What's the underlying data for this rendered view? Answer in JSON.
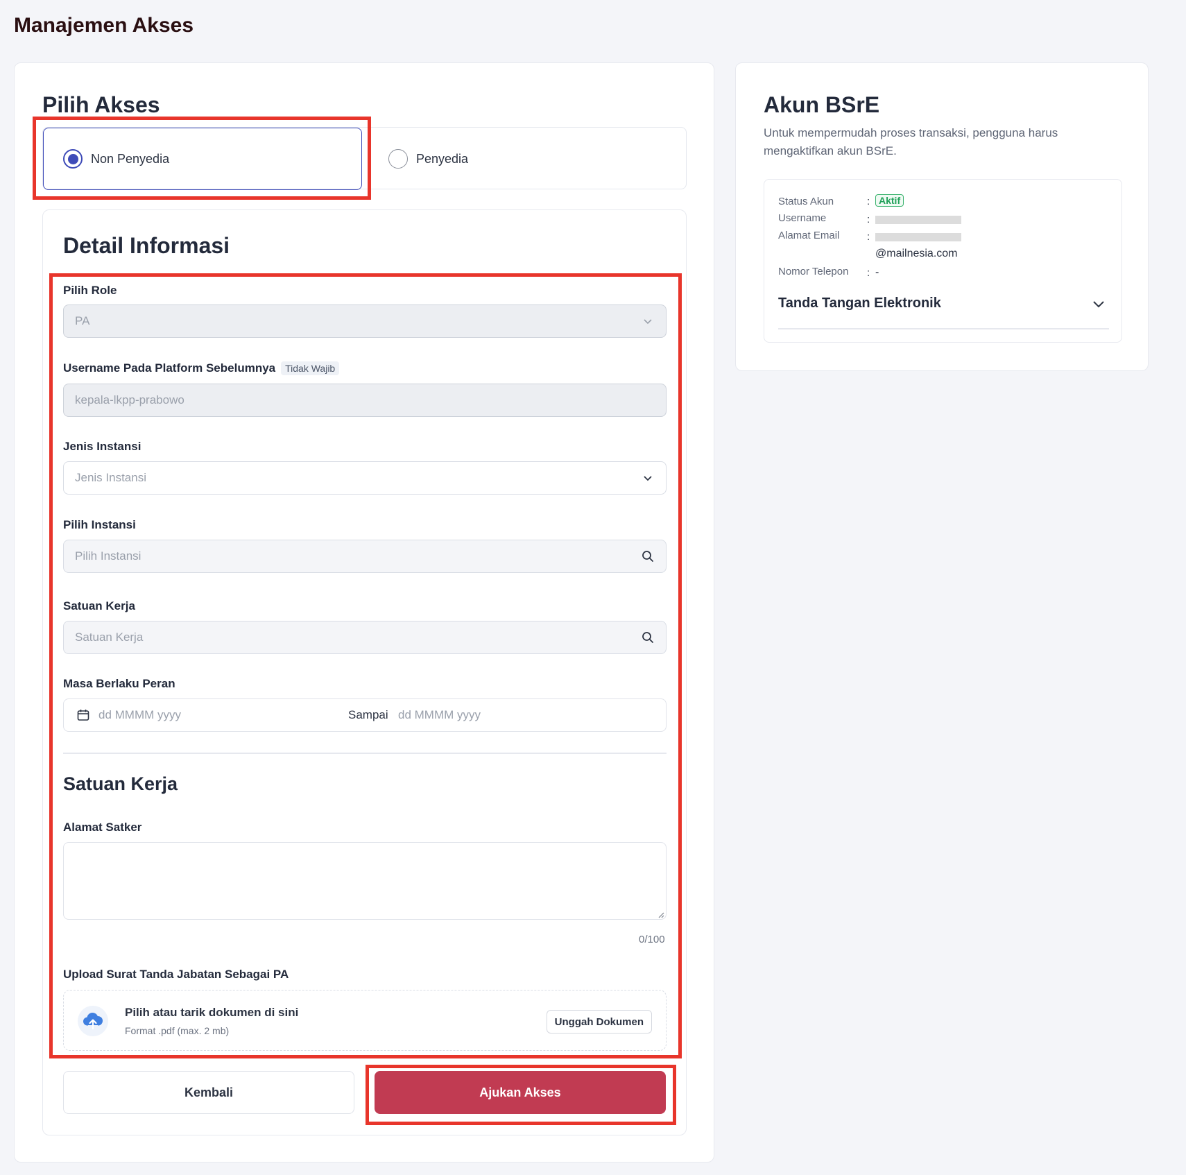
{
  "page": {
    "title": "Manajemen Akses"
  },
  "access": {
    "title": "Pilih Akses",
    "options": [
      {
        "label": "Non Penyedia",
        "selected": true
      },
      {
        "label": "Penyedia",
        "selected": false
      }
    ]
  },
  "detail": {
    "title": "Detail Informasi",
    "role": {
      "label": "Pilih Role",
      "value": "PA"
    },
    "username": {
      "label": "Username Pada Platform Sebelumnya",
      "badge": "Tidak Wajib",
      "placeholder": "kepala-lkpp-prabowo"
    },
    "jenis_instansi": {
      "label": "Jenis Instansi",
      "placeholder": "Jenis Instansi"
    },
    "instansi": {
      "label": "Pilih Instansi",
      "placeholder": "Pilih Instansi"
    },
    "satuan_kerja": {
      "label": "Satuan Kerja",
      "placeholder": "Satuan Kerja"
    },
    "masa_berlaku": {
      "label": "Masa Berlaku Peran",
      "start_placeholder": "dd MMMM yyyy",
      "separator": "Sampai",
      "end_placeholder": "dd MMMM yyyy"
    }
  },
  "satker": {
    "title": "Satuan Kerja",
    "alamat": {
      "label": "Alamat Satker",
      "value": "",
      "counter": "0/100"
    },
    "upload": {
      "label": "Upload Surat Tanda Jabatan Sebagai PA",
      "title": "Pilih atau tarik dokumen di sini",
      "subtitle": "Format .pdf (max. 2 mb)",
      "button": "Unggah Dokumen"
    }
  },
  "actions": {
    "back": "Kembali",
    "submit": "Ajukan Akses"
  },
  "bsre": {
    "title": "Akun BSrE",
    "description": "Untuk mempermudah proses transaksi, pengguna harus mengaktifkan akun BSrE.",
    "status_label": "Status Akun",
    "status_value": "Aktif",
    "username_label": "Username",
    "email_label": "Alamat Email",
    "email_suffix": "@mailnesia.com",
    "phone_label": "Nomor Telepon",
    "phone_value": "-",
    "colon": ":",
    "signature_title": "Tanda Tangan Elektronik"
  },
  "colors": {
    "primary": "#3e4bb8",
    "submit": "#c13b52",
    "highlight": "#e8352b",
    "success": "#22a15a"
  }
}
